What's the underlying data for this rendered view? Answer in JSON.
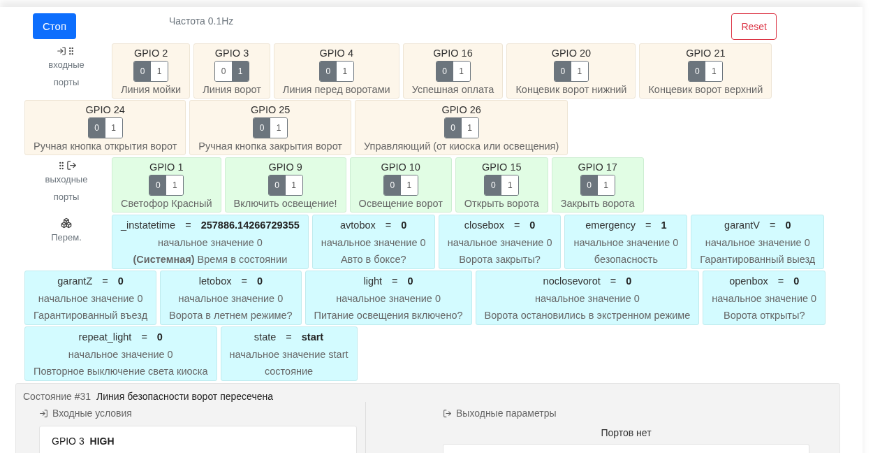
{
  "header": {
    "stop_button": "Стоп",
    "frequency": "Частота 0.1Hz",
    "reset_button": "Reset"
  },
  "sections": [
    {
      "kind": "inputs",
      "label": "входные порты",
      "ports": [
        {
          "name": "GPIO 2",
          "description": "Линия мойки",
          "toggle": [
            {
              "label": "0",
              "selected": true
            },
            {
              "label": "1",
              "selected": false
            }
          ]
        },
        {
          "name": "GPIO 3",
          "description": "Линия ворот",
          "toggle": [
            {
              "label": "0",
              "selected": false
            },
            {
              "label": "1",
              "selected": true
            }
          ]
        },
        {
          "name": "GPIO 4",
          "description": "Линия перед воротами",
          "toggle": [
            {
              "label": "0",
              "selected": true
            },
            {
              "label": "1",
              "selected": false
            }
          ]
        },
        {
          "name": "GPIO 16",
          "description": "Успешная оплата",
          "toggle": [
            {
              "label": "0",
              "selected": true
            },
            {
              "label": "1",
              "selected": false
            }
          ]
        },
        {
          "name": "GPIO 20",
          "description": "Концевик ворот нижний",
          "toggle": [
            {
              "label": "0",
              "selected": true
            },
            {
              "label": "1",
              "selected": false
            }
          ]
        },
        {
          "name": "GPIO 21",
          "description": "Концевик ворот верхний",
          "toggle": [
            {
              "label": "0",
              "selected": true
            },
            {
              "label": "1",
              "selected": false
            }
          ]
        },
        {
          "name": "GPIO 24",
          "description": "Ручная кнопка открытия ворот",
          "toggle": [
            {
              "label": "0",
              "selected": true
            },
            {
              "label": "1",
              "selected": false
            }
          ]
        },
        {
          "name": "GPIO 25",
          "description": "Ручная кнопка закрытия ворот",
          "toggle": [
            {
              "label": "0",
              "selected": true
            },
            {
              "label": "1",
              "selected": false
            }
          ]
        },
        {
          "name": "GPIO 26",
          "description": "Управляющий (от киоска или освещения)",
          "toggle": [
            {
              "label": "0",
              "selected": true
            },
            {
              "label": "1",
              "selected": false
            }
          ]
        }
      ]
    },
    {
      "kind": "outputs",
      "label": "выходные порты",
      "ports": [
        {
          "name": "GPIO 1",
          "description": "Светофор Красный",
          "toggle": [
            {
              "label": "0",
              "selected": true
            },
            {
              "label": "1",
              "selected": false
            }
          ]
        },
        {
          "name": "GPIO 9",
          "description": "Включить освещение!",
          "toggle": [
            {
              "label": "0",
              "selected": true
            },
            {
              "label": "1",
              "selected": false
            }
          ]
        },
        {
          "name": "GPIO 10",
          "description": "Освещение ворот",
          "toggle": [
            {
              "label": "0",
              "selected": true
            },
            {
              "label": "1",
              "selected": false
            }
          ]
        },
        {
          "name": "GPIO 15",
          "description": "Открыть ворота",
          "toggle": [
            {
              "label": "0",
              "selected": true
            },
            {
              "label": "1",
              "selected": false
            }
          ]
        },
        {
          "name": "GPIO 17",
          "description": "Закрыть ворота",
          "toggle": [
            {
              "label": "0",
              "selected": true
            },
            {
              "label": "1",
              "selected": false
            }
          ]
        }
      ]
    },
    {
      "kind": "variables",
      "label": "Перем.",
      "variables": [
        {
          "name": "_instatetime",
          "sign": "=",
          "value": "257886.14266729355",
          "initial": "начальное значение 0",
          "description": "**(Системная)** Время в состоянии"
        },
        {
          "name": "avtobox",
          "sign": "=",
          "value": "0",
          "initial": "начальное значение 0",
          "description": "Авто в боксе?"
        },
        {
          "name": "closebox",
          "sign": "=",
          "value": "0",
          "initial": "начальное значение 0",
          "description": "Ворота закрыты?"
        },
        {
          "name": "emergency",
          "sign": "=",
          "value": "1",
          "initial": "начальное значение 0",
          "description": "безопасность"
        },
        {
          "name": "garantV",
          "sign": "=",
          "value": "0",
          "initial": "начальное значение 0",
          "description": "Гарантированный выезд"
        },
        {
          "name": "garantZ",
          "sign": "=",
          "value": "0",
          "initial": "начальное значение 0",
          "description": "Гарантированный въезд"
        },
        {
          "name": "letobox",
          "sign": "=",
          "value": "0",
          "initial": "начальное значение 0",
          "description": "Ворота в летнем режиме?"
        },
        {
          "name": "light",
          "sign": "=",
          "value": "0",
          "initial": "начальное значение 0",
          "description": "Питание освещения включено?"
        },
        {
          "name": "noclosevorot",
          "sign": "=",
          "value": "0",
          "initial": "начальное значение 0",
          "description": "Ворота остановились в экстренном режиме"
        },
        {
          "name": "openbox",
          "sign": "=",
          "value": "0",
          "initial": "начальное значение 0",
          "description": "Ворота открыты?"
        },
        {
          "name": "repeat_light",
          "sign": "=",
          "value": "0",
          "initial": "начальное значение 0",
          "description": "Повторное выключение света киоска"
        },
        {
          "name": "state",
          "sign": "=",
          "value": "start",
          "initial": "начальное значение start",
          "description": "состояние"
        }
      ]
    }
  ],
  "state_panel": {
    "number": "Состояние #31",
    "title": "Линия безопасности ворот пересечена",
    "inputs": {
      "heading": "Входные условия",
      "conditions": [
        {
          "port": "GPIO 3",
          "level": "HIGH"
        }
      ]
    },
    "outputs": {
      "heading": "Выходные параметры",
      "empty_text": "Портов нет"
    }
  }
}
